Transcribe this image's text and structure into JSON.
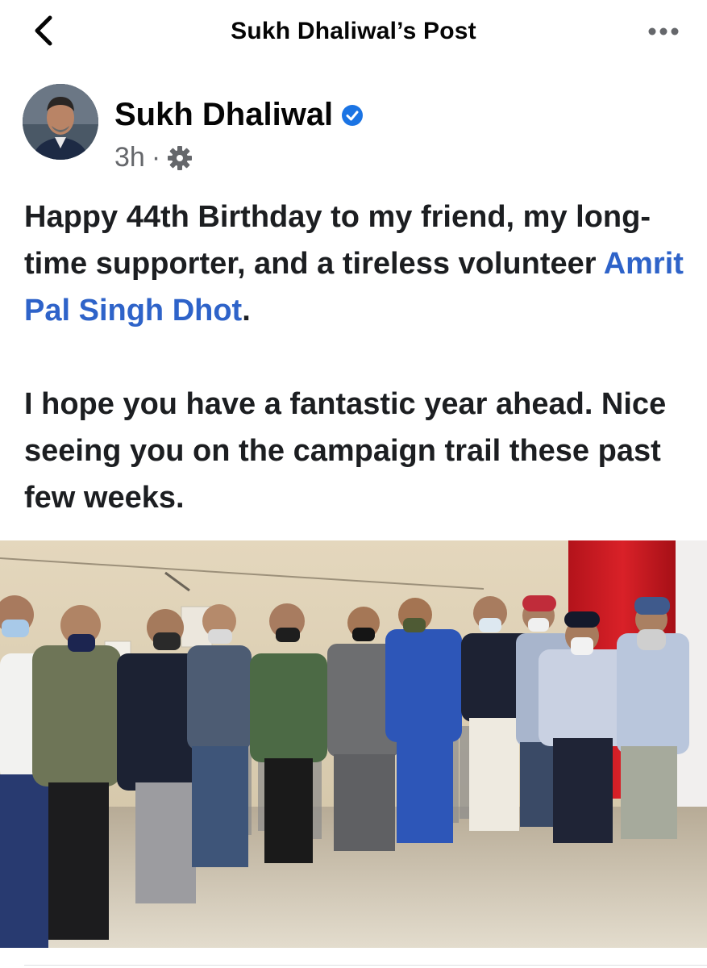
{
  "header": {
    "title": "Sukh Dhaliwal’s Post",
    "back_icon": "chevron-left-icon",
    "more_icon": "more-horizontal-icon"
  },
  "author": {
    "name": "Sukh Dhaliwal",
    "verified": true,
    "verified_icon": "verified-badge-icon",
    "time": "3h",
    "separator": "·",
    "privacy_icon": "gear-icon"
  },
  "post": {
    "p1_before": "Happy 44th Birthday to my friend, my long-time supporter, and a tireless volunteer ",
    "mention": "Amrit Pal Singh Dhot",
    "p1_after": ".",
    "p2": "I hope you have a fantastic year ahead. Nice seeing you on the campaign trail these past few weeks."
  },
  "photo": {
    "people_count": 12
  },
  "colors": {
    "link": "#2e63c9",
    "verified": "#1b74e4",
    "meta": "#65676b"
  }
}
